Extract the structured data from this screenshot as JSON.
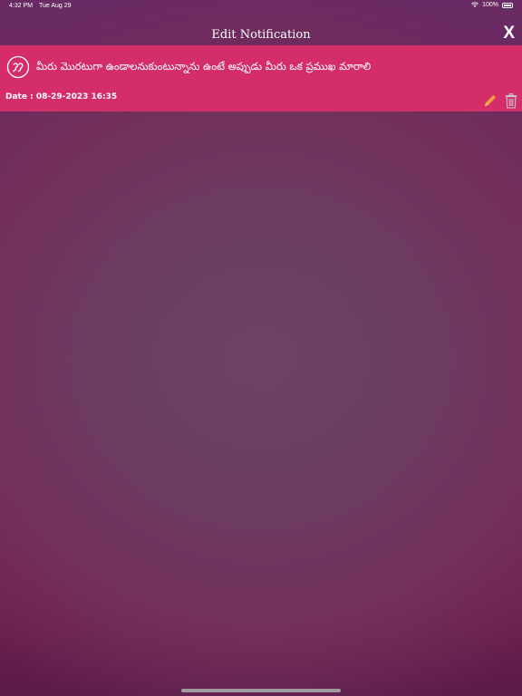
{
  "status_bar": {
    "time": "4:32 PM",
    "date": "Tue Aug 29",
    "battery": "100%",
    "icons": [
      "wifi-icon",
      "battery-icon"
    ]
  },
  "nav": {
    "title": "Edit Notification",
    "close_label": "X"
  },
  "notification": {
    "icon": "quote-icon",
    "message": "మీరు మొరటుగా ఉండాలనుకుంటున్నాను ఉంటే అప్పుడు మీరు ఒక ప్రముఖ మారాలి",
    "date": "Date : 08-29-2023 16:35",
    "actions": [
      "edit-icon",
      "delete-icon"
    ]
  },
  "colors": {
    "card_background": "#d42d69",
    "edit_icon": "#f2a33a",
    "background_top": "#6a2a63",
    "background_bottom": "#5a1a4a"
  }
}
